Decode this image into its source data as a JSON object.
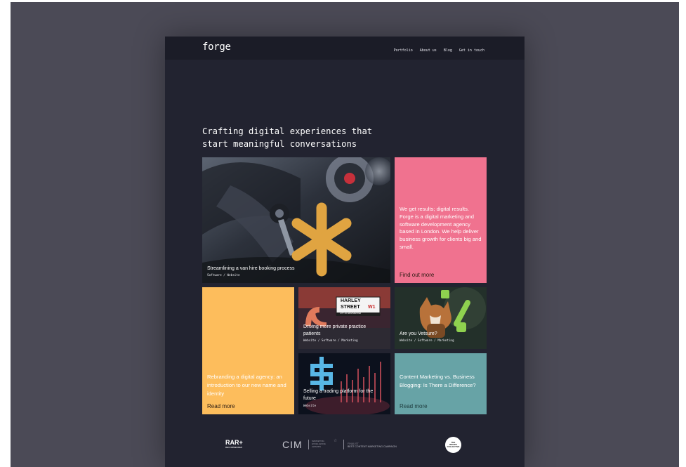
{
  "brand": {
    "logo_text": "forge"
  },
  "nav": {
    "items": [
      "Portfolio",
      "About us",
      "Blog",
      "Get in touch"
    ]
  },
  "hero": {
    "headline_line1": "Crafting digital experiences that",
    "headline_line2": "start meaningful conversations"
  },
  "tiles": {
    "van_hire": {
      "title": "Streamlining a van hire booking process",
      "tags": "Software / Website"
    },
    "intro": {
      "text": "We get results; digital results. Forge is a digital marketing and software development agency based in London. We help deliver business growth for clients big and small.",
      "cta": "Find out more"
    },
    "rebrand": {
      "title": "Rebranding a digital agency: an introduction to our new name and identity",
      "cta": "Read more"
    },
    "harley": {
      "title": "Driving more private practice patients",
      "tags": "Website / Software / Marketing",
      "sign_line1": "HARLEY",
      "sign_line2": "STREET",
      "sign_code": "W1",
      "sign_sub": "CITY OF WESTMINSTER"
    },
    "vetsure": {
      "title": "Are you Vetsure?",
      "tags": "Website / Software / Marketing"
    },
    "trading": {
      "title": "Selling a trading platform for the future",
      "tags": "Website"
    },
    "content": {
      "title": "Content Marketing vs. Business Blogging: Is There a Difference?",
      "cta": "Read more"
    }
  },
  "footer_logos": {
    "rar": "RAR+",
    "rar_sub": "RECOMMENDED",
    "cim": "CIM",
    "cim_awards_line1": "MARKETING",
    "cim_awards_line2": "EXCELLENCE",
    "cim_awards_line3": "AWARDS",
    "cim_finalist": "FINALIST",
    "cim_category": "BEST CONTENT MARKETING CAMPAIGN",
    "badge_line1": "THE",
    "badge_line2": "RECIPE",
    "badge_line3": "COLLECTIVE"
  },
  "colors": {
    "pink": "#f0728f",
    "yellow": "#fdbd5c",
    "teal": "#67a3a6",
    "page": "#222330",
    "accent_gold": "#e0a441"
  }
}
